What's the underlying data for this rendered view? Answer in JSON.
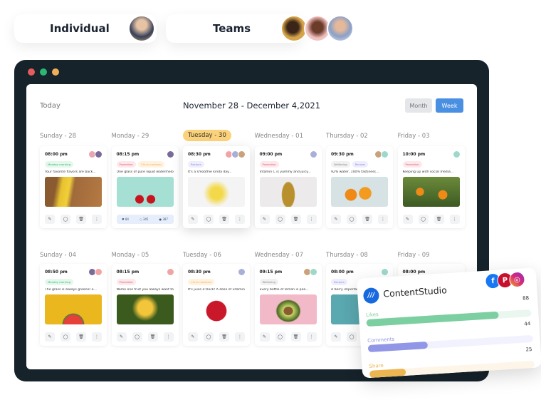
{
  "plans": [
    {
      "label": "Individual"
    },
    {
      "label": "Teams"
    }
  ],
  "header": {
    "today": "Today",
    "title": "November 28 - December 4,2021",
    "month": "Month",
    "week": "Week"
  },
  "colors": {
    "accent": "#4a90e2",
    "window": "#16232b",
    "current_day": "#fbd27a"
  },
  "rows": [
    {
      "days": [
        "Sunday - 28",
        "Monday - 29",
        "Tuesday - 30",
        "Wednesday - 01",
        "Thursday - 02",
        "Friday - 03"
      ],
      "cards": [
        {
          "time": "08:00 pm",
          "tags": [
            "Monday morning"
          ],
          "text": "Your favorite flavors are back...",
          "image": "banana",
          "avatars": 2
        },
        {
          "time": "08:15 pm",
          "tags": [
            "Promotion",
            "Citrus madness"
          ],
          "text": "One glass of pure liquid watermelon...",
          "image": "cherries",
          "avatars": 1,
          "stats": [
            "84",
            "345",
            "387"
          ]
        },
        {
          "time": "08:30 pm",
          "tags": [
            "Recipes"
          ],
          "text": "It's a smoothie kinda day...",
          "image": "lemons",
          "avatars": 3
        },
        {
          "time": "09:00 pm",
          "tags": [
            "Promotion"
          ],
          "text": "Vitamin C is yummy and juicy...",
          "image": "pineapple",
          "avatars": 1
        },
        {
          "time": "09:30 pm",
          "tags": [
            "Wellbeing",
            "Recipes"
          ],
          "text": "92% water, 100% tastiness...",
          "image": "oranges",
          "avatars": 2
        },
        {
          "time": "10:00 pm",
          "tags": [
            "Promotion"
          ],
          "text": "Keeping up with social media...",
          "image": "orange-tree",
          "avatars": 1
        }
      ]
    },
    {
      "days": [
        "Sunday - 04",
        "Monday - 05",
        "Tuesday - 06",
        "Wednesday - 07",
        "Thursday - 08",
        "Friday - 09"
      ],
      "cards": [
        {
          "time": "08:50 pm",
          "tags": [
            "Monday morning"
          ],
          "text": "The grass is always greener o...",
          "image": "watermelon",
          "avatars": 2
        },
        {
          "time": "08:15 pm",
          "tags": [
            "Promotion"
          ],
          "text": "Name one fruit you always want to...",
          "image": "flowers",
          "avatars": 1
        },
        {
          "time": "08:30 pm",
          "tags": [
            "Citrus madness"
          ],
          "text": "It's juice o'clock! A dose of vitamin C...",
          "image": "pomegranate",
          "avatars": 1
        },
        {
          "time": "09:15 pm",
          "tags": [
            "Wellbeing"
          ],
          "text": "Every bottle of lemon is pea...",
          "image": "avocado",
          "avatars": 2
        },
        {
          "time": "08:00 pm",
          "tags": [
            "Recipes"
          ],
          "text": "A berry important...",
          "image": "teal",
          "avatars": 1
        },
        {
          "time": "08:00 pm",
          "tags": [],
          "text": "",
          "image": "none",
          "avatars": 0
        }
      ]
    }
  ],
  "analytics": {
    "brand": "ContentStudio",
    "networks": [
      "facebook",
      "pinterest",
      "instagram"
    ],
    "metrics": [
      {
        "label": "Likes",
        "value": "88",
        "fill": 0.8,
        "color": "#7ccfa0",
        "track": "#eaf7ef"
      },
      {
        "label": "Comments",
        "value": "44",
        "fill": 0.36,
        "color": "#9196e6",
        "track": "#f1f2fd"
      },
      {
        "label": "Share",
        "value": "25",
        "fill": 0.22,
        "color": "#ecb552",
        "track": "#fdf6e8"
      }
    ]
  }
}
